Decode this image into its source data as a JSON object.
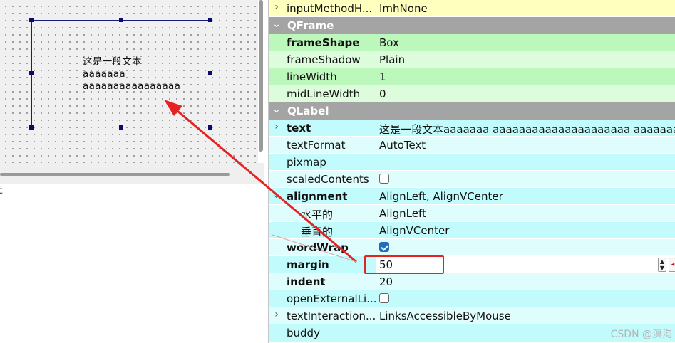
{
  "designer": {
    "label_lines": [
      "这是一段文本",
      "aaaaaaa",
      "aaaaaaaaaaaaaaaa"
    ],
    "bottom_header_text": "c"
  },
  "props": {
    "rows": [
      {
        "name": "inputMethodH...",
        "value": "ImhNone",
        "bold": false
      },
      {
        "category": "QFrame"
      },
      {
        "name": "frameShape",
        "value": "Box",
        "bold": true
      },
      {
        "name": "frameShadow",
        "value": "Plain",
        "bold": false
      },
      {
        "name": "lineWidth",
        "value": "1",
        "bold": false
      },
      {
        "name": "midLineWidth",
        "value": "0",
        "bold": false
      },
      {
        "category": "QLabel"
      },
      {
        "name": "text",
        "value": "这是一段文本aaaaaaa aaaaaaaaaaaaaaaaaaaaa aaaaaaaaa...",
        "bold": true
      },
      {
        "name": "textFormat",
        "value": "AutoText",
        "bold": false
      },
      {
        "name": "pixmap",
        "value": "",
        "bold": false
      },
      {
        "name": "scaledContents",
        "checked": false,
        "bold": false
      },
      {
        "name": "alignment",
        "value": "AlignLeft, AlignVCenter",
        "bold": true
      },
      {
        "name": "水平的",
        "value": "AlignLeft",
        "bold": false
      },
      {
        "name": "垂直的",
        "value": "AlignVCenter",
        "bold": false
      },
      {
        "name": "wordWrap",
        "checked": true,
        "bold": true
      },
      {
        "name": "margin",
        "value": "50",
        "bold": true
      },
      {
        "name": "indent",
        "value": "20",
        "bold": true
      },
      {
        "name": "openExternalLi...",
        "checked": false,
        "bold": false
      },
      {
        "name": "textInteraction...",
        "value": "LinksAccessibleByMouse",
        "bold": false
      },
      {
        "name": "buddy",
        "value": "",
        "bold": false
      }
    ]
  },
  "icons": {
    "collapsed": "chevron-right-icon",
    "expanded": "chevron-down-icon",
    "spin": "spinbox-arrows-icon",
    "reset": "reset-icon"
  },
  "colors": {
    "highlight": "#e52222",
    "arrow": "#e52222",
    "qframe_row": "#bcf7bb",
    "qlabel_row": "#c1fbfb",
    "category": "#a4a4a4"
  },
  "watermark": "CSDN @溟洵"
}
